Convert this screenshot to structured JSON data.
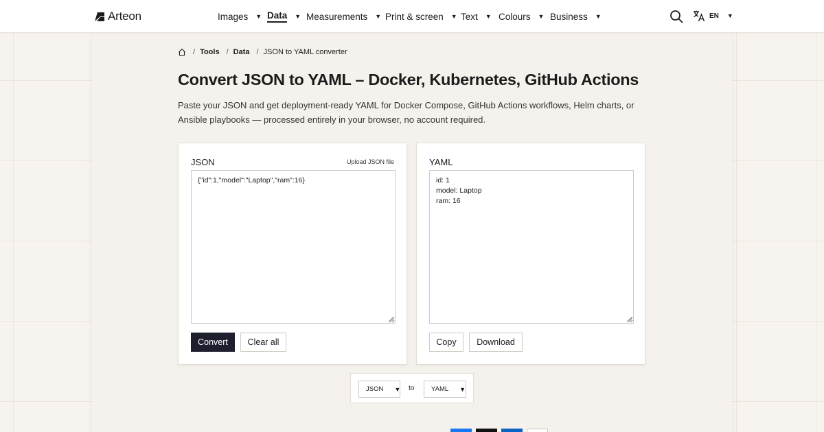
{
  "header": {
    "logo_text": "Arteon",
    "nav": [
      {
        "label": "Images",
        "active": false
      },
      {
        "label": "Data",
        "active": true
      },
      {
        "label": "Measurements",
        "active": false
      },
      {
        "label": "Print & screen",
        "active": false
      },
      {
        "label": "Text",
        "active": false
      },
      {
        "label": "Colours",
        "active": false
      },
      {
        "label": "Business",
        "active": false
      }
    ],
    "caret": "▼",
    "language": "EN",
    "icons": {
      "search": "search-icon",
      "language": "translate-icon",
      "logo": "arteon-logo-icon"
    }
  },
  "breadcrumb": {
    "items": [
      {
        "label": "Tools",
        "link": true
      },
      {
        "label": "Data",
        "link": true
      },
      {
        "label": "JSON to YAML converter",
        "link": false
      }
    ],
    "separator": "/"
  },
  "page": {
    "title": "Convert JSON to YAML – Docker, Kubernetes, GitHub Actions",
    "description": "Paste your JSON and get deployment-ready YAML for Docker Compose, GitHub Actions workflows, Helm charts, or Ansible playbooks — processed entirely in your browser, no account required."
  },
  "input_panel": {
    "title": "JSON",
    "upload_label": "Upload JSON file",
    "lines": [
      "{\"id\":1,\"model\":\"Laptop\",\"ram\":16}"
    ],
    "convert_label": "Convert",
    "clear_label": "Clear all"
  },
  "output_panel": {
    "title": "YAML",
    "lines": [
      "id: 1",
      "model: Laptop",
      "ram: 16"
    ],
    "copy_label": "Copy",
    "download_label": "Download"
  },
  "format_selector": {
    "from": "JSON",
    "to_label": "to",
    "to": "YAML"
  },
  "colors": {
    "primary_button": "#1e1f2e",
    "background": "#f7f4ef",
    "share_buttons": [
      "#1877f2",
      "#111111",
      "#0a66c2",
      "#ffffff"
    ]
  }
}
